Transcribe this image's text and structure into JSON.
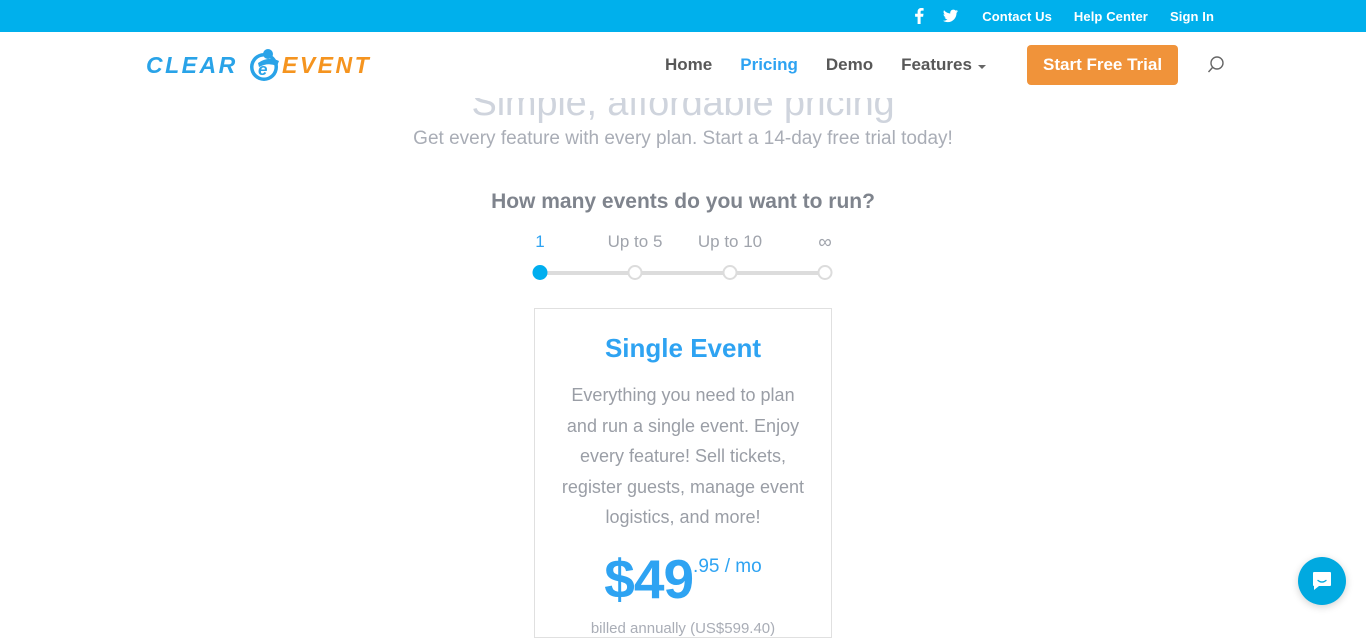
{
  "topbar": {
    "social": [
      {
        "name": "facebook-icon",
        "label": "Facebook"
      },
      {
        "name": "twitter-icon",
        "label": "Twitter"
      }
    ],
    "links": [
      {
        "label": "Contact Us"
      },
      {
        "label": "Help Center"
      },
      {
        "label": "Sign In"
      }
    ],
    "background_color": "#00b0ec"
  },
  "header": {
    "logo": {
      "text_primary": "CLEAR",
      "text_secondary": "EVENT",
      "mark": "e",
      "primary_color": "#29a3e8",
      "secondary_color": "#f5941f"
    },
    "nav": [
      {
        "label": "Home",
        "active": false
      },
      {
        "label": "Pricing",
        "active": true
      },
      {
        "label": "Demo",
        "active": false
      },
      {
        "label": "Features",
        "active": false,
        "has_dropdown": true
      }
    ],
    "cta_label": "Start Free Trial",
    "cta_color": "#f0933a",
    "search_icon": "search-icon",
    "active_color": "#2ea3f2"
  },
  "hero": {
    "title": "Simple, affordable pricing",
    "subtitle": "Get every feature with every plan. Start a 14-day free trial today!"
  },
  "selector": {
    "question": "How many events do you want to run?",
    "options": [
      {
        "label": "1",
        "selected": true
      },
      {
        "label": "Up to 5",
        "selected": false
      },
      {
        "label": "Up to 10",
        "selected": false
      },
      {
        "label": "∞",
        "selected": false
      }
    ],
    "selected_index": 0,
    "accent_color": "#00aeef"
  },
  "plan": {
    "title": "Single Event",
    "description": "Everything you need to plan and run a single event. Enjoy every feature! Sell tickets, register guests, manage event logistics, and more!",
    "price_main": "$49",
    "price_cents": ".95 / mo",
    "billing_note": "billed annually (US$599.40)"
  },
  "chat": {
    "icon": "chat-bubble-icon",
    "color": "#00a9e0"
  }
}
